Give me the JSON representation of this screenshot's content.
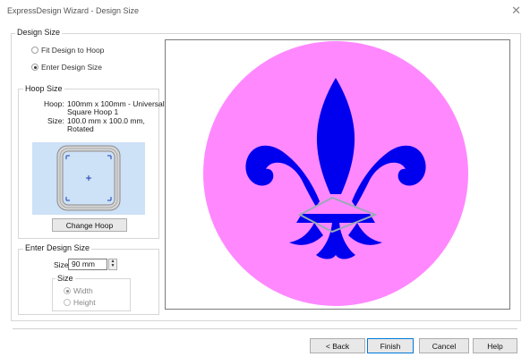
{
  "window": {
    "title": "ExpressDesign Wizard - Design Size",
    "close_glyph": "✕"
  },
  "design_size_group": {
    "label": "Design Size",
    "options": [
      {
        "label": "Fit Design to Hoop",
        "checked": false
      },
      {
        "label": "Enter Design Size",
        "checked": true
      }
    ]
  },
  "hoop_size_group": {
    "label": "Hoop Size",
    "hoop_key": "Hoop:",
    "hoop_value_line1": "100mm x 100mm - Universal",
    "hoop_value_line2": "Square Hoop 1",
    "size_key": "Size:",
    "size_value_line1": "100.0 mm x 100.0 mm,",
    "size_value_line2": "Rotated",
    "change_hoop_label": "Change Hoop"
  },
  "enter_design_size_group": {
    "label": "Enter Design Size",
    "size_label": "Size",
    "size_value": "90 mm",
    "spin_up": "▲",
    "spin_down": "▼",
    "sub_group_label": "Size",
    "options": [
      {
        "label": "Width",
        "checked": true,
        "disabled": true
      },
      {
        "label": "Height",
        "checked": false,
        "disabled": true
      }
    ]
  },
  "preview": {
    "background_color": "#ff88ff",
    "design_color": "#0000ee",
    "outline_color": "#9aa8b8"
  },
  "footer": {
    "back_label": "< Back",
    "finish_label": "Finish",
    "cancel_label": "Cancel",
    "help_label": "Help"
  },
  "colors": {
    "hoop_background": "#cde1f7",
    "accent_border": "#0078d7"
  }
}
